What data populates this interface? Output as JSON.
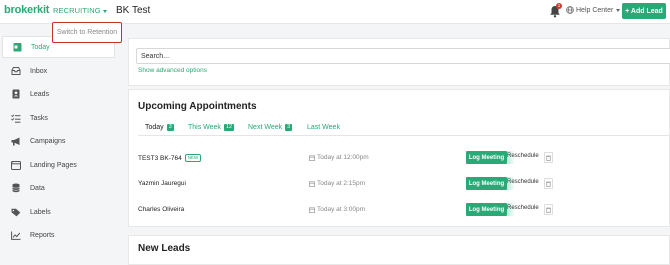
{
  "header": {
    "logo": "brokerkit",
    "mode_label": "RECRUITING",
    "page_title": "BK Test",
    "notification_count": "1",
    "help_label": "Help Center",
    "add_lead_label": "+ Add Lead"
  },
  "dropdown": {
    "switch_label": "Switch to Retention"
  },
  "sidebar": {
    "items": [
      {
        "label": "Today",
        "icon": "calendar-icon"
      },
      {
        "label": "Inbox",
        "icon": "inbox-icon"
      },
      {
        "label": "Leads",
        "icon": "contact-book-icon"
      },
      {
        "label": "Tasks",
        "icon": "tasks-icon"
      },
      {
        "label": "Campaigns",
        "icon": "megaphone-icon"
      },
      {
        "label": "Landing Pages",
        "icon": "landing-page-icon"
      },
      {
        "label": "Data",
        "icon": "database-icon"
      },
      {
        "label": "Labels",
        "icon": "tag-icon"
      },
      {
        "label": "Reports",
        "icon": "chart-icon"
      }
    ]
  },
  "search": {
    "placeholder": "Search...",
    "advanced_label": "Show advanced options"
  },
  "appointments": {
    "title": "Upcoming Appointments",
    "tabs": [
      {
        "label": "Today",
        "count": "3"
      },
      {
        "label": "This Week",
        "count": "12"
      },
      {
        "label": "Next Week",
        "count": "3"
      },
      {
        "label": "Last Week",
        "count": ""
      }
    ],
    "new_badge": "NEW",
    "log_label": "Log Meeting",
    "reschedule_label": "Reschedule",
    "rows": [
      {
        "name": "TEST3 BK-764",
        "when": "Today at 12:00pm"
      },
      {
        "name": "Yazmin Jauregui",
        "when": "Today at 2:15pm"
      },
      {
        "name": "Charles Oliveira",
        "when": "Today at 3:00pm"
      }
    ]
  },
  "new_leads": {
    "title": "New Leads"
  },
  "colors": {
    "accent": "#2aa876",
    "badge_red": "#d9342b",
    "highlight_red": "#c9302c"
  }
}
